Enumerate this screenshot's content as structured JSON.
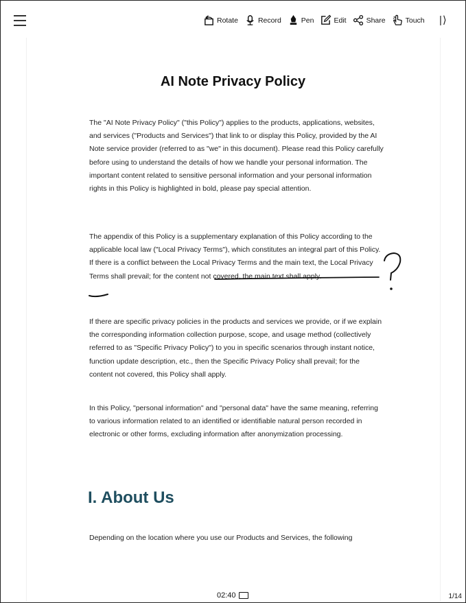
{
  "toolbar": {
    "items": [
      {
        "label": "Rotate",
        "icon": "rotate-icon"
      },
      {
        "label": "Record",
        "icon": "microphone-icon"
      },
      {
        "label": "Pen",
        "icon": "pen-icon"
      },
      {
        "label": "Edit",
        "icon": "edit-icon"
      },
      {
        "label": "Share",
        "icon": "share-icon"
      },
      {
        "label": "Touch",
        "icon": "touch-icon"
      }
    ],
    "collapse_glyph": "|⟩"
  },
  "document": {
    "title": "AI Note Privacy Policy",
    "paragraphs": [
      "The \"AI Note Privacy Policy\" (\"this Policy\") applies to the products, applications, websites, and services (\"Products and Services\") that link to or display this Policy, provided by the AI Note service provider (referred to as \"we\" in this document). Please read this Policy carefully before using to understand the details of how we handle your personal information. The important content related to sensitive personal information and your personal information rights in this Policy is highlighted in bold, please pay special attention.",
      "The appendix of this Policy is a supplementary explanation of this Policy according to the applicable local law (\"Local Privacy Terms\"), which constitutes an integral part of this Policy. If there is a conflict between the Local Privacy Terms and the main text, the Local Privacy Terms shall prevail; for the content not covered, the main text shall apply.",
      "If there are specific privacy policies in the products and services we provide, or if we explain the corresponding information collection purpose, scope, and usage method (collectively referred to as \"Specific Privacy Policy\") to you in specific scenarios through instant notice, function update description, etc., then the Specific Privacy Policy shall prevail; for the content not covered, this Policy shall apply.",
      "In this Policy, \"personal information\" and \"personal data\" have the same meaning, referring to various information related to an identified or identifiable natural person recorded in electronic or other forms, excluding information after anonymization processing."
    ],
    "section_heading": "I. About Us",
    "section_paragraph": "Depending on the location where you use our Products and Services, the following"
  },
  "footer": {
    "time": "02:40",
    "page_indicator": "1/14"
  },
  "colors": {
    "heading": "#1f4e5f",
    "ink": "#111111"
  }
}
